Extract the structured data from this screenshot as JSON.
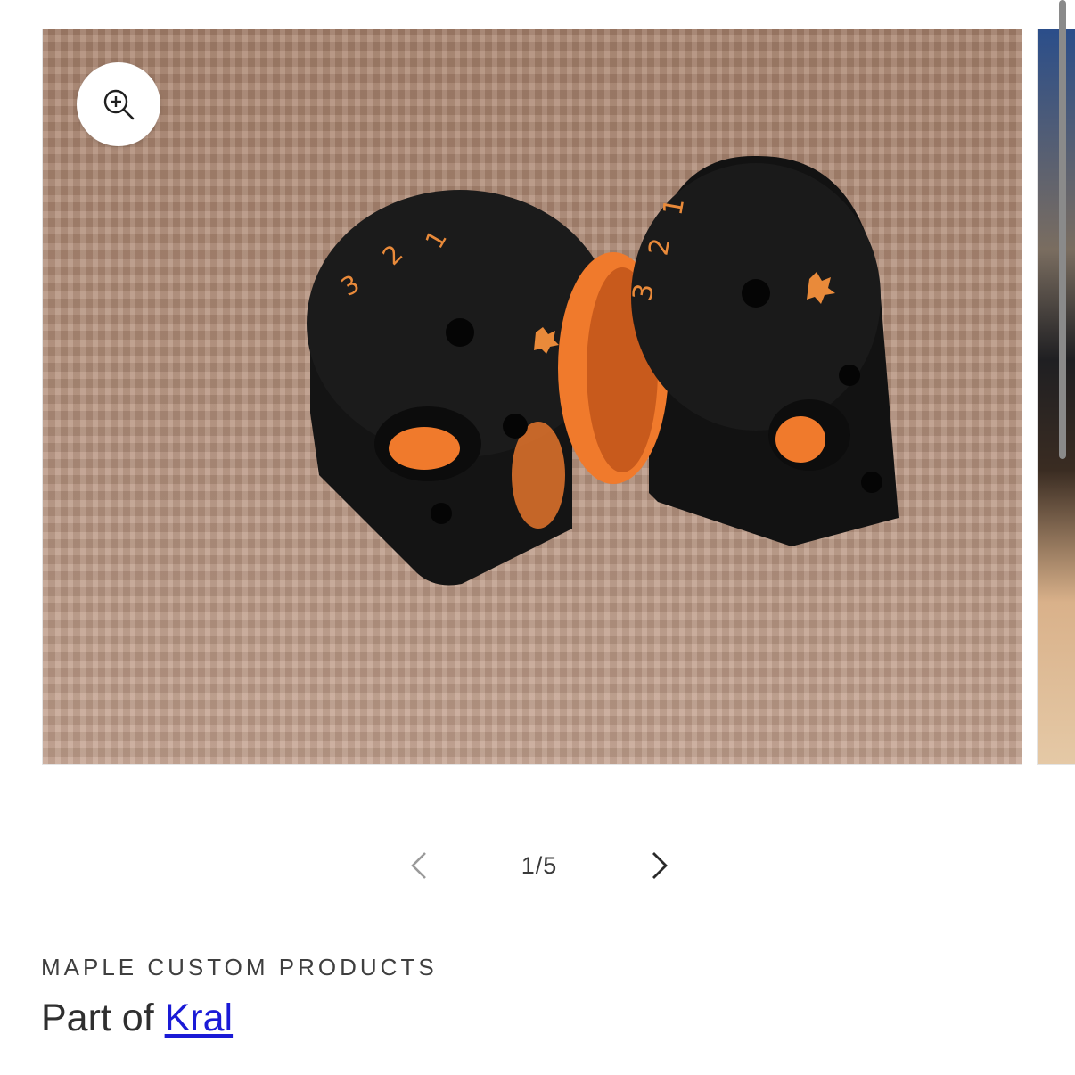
{
  "gallery": {
    "current_slide": 1,
    "total_slides": 5,
    "counter_text": "1/5",
    "zoom_button_label": "Zoom",
    "prev_icon": "chevron-left-icon",
    "next_icon": "chevron-right-icon",
    "zoom_icon": "zoom-in-icon",
    "main_image": {
      "alt": "Two black and orange 3D printed magazines on a woven surface",
      "dial_numbers": [
        "3",
        "2",
        "1"
      ]
    }
  },
  "product": {
    "vendor": "MAPLE CUSTOM PRODUCTS",
    "title_prefix": "Part of ",
    "collection_link": "Kral"
  },
  "colors": {
    "link": "#1a1ad6",
    "accent_orange": "#f07a2c",
    "text": "#2f2f2f"
  }
}
